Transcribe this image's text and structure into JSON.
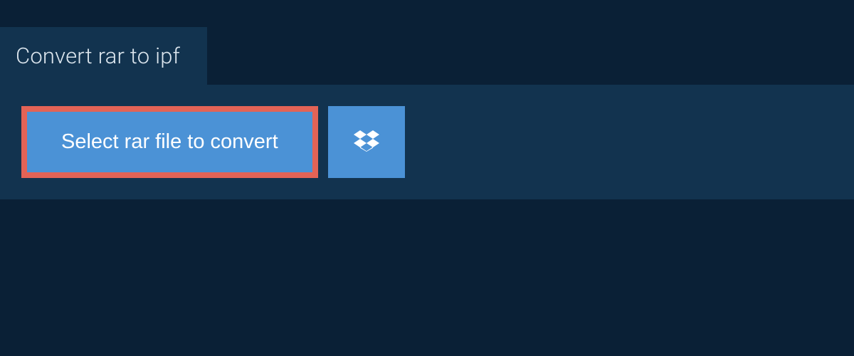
{
  "header": {
    "title": "Convert rar to ipf"
  },
  "actions": {
    "select_file_label": "Select rar file to convert"
  },
  "colors": {
    "page_bg": "#0a2036",
    "panel_bg": "#12334f",
    "button_bg": "#4b92d6",
    "highlight_border": "#e36356",
    "text_light": "#dce6ee",
    "text_white": "#ffffff"
  }
}
